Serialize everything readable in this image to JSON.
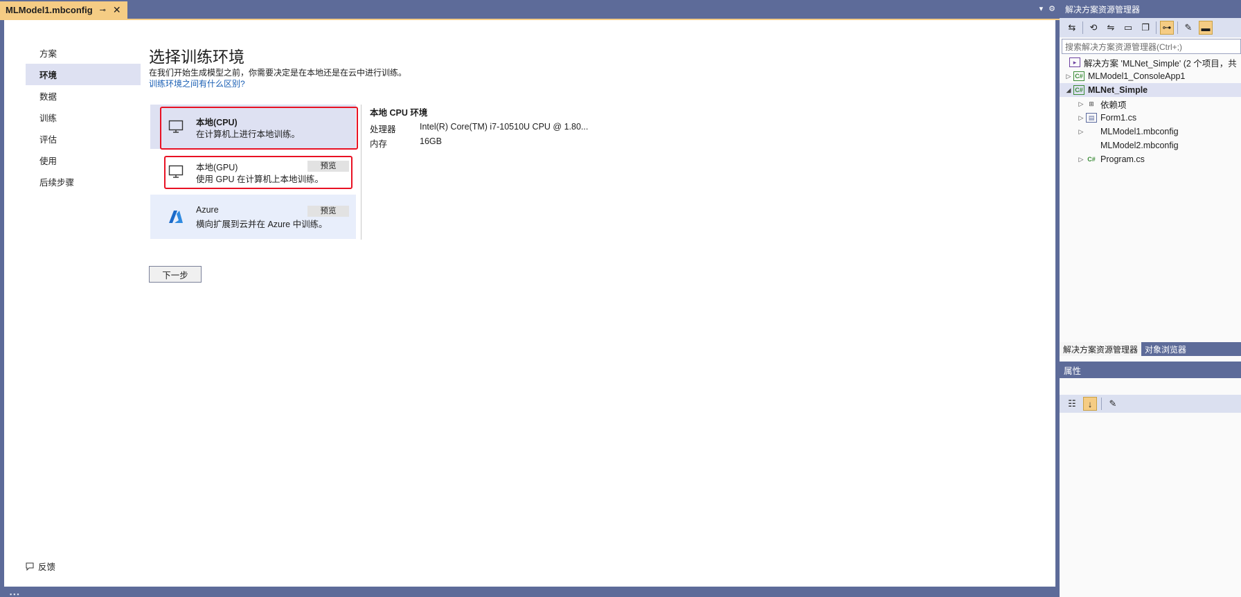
{
  "document_tab": {
    "title": "MLModel1.mbconfig",
    "pin_icon": "pin-icon",
    "close_icon": "close-icon"
  },
  "nav": {
    "items": [
      "方案",
      "环境",
      "数据",
      "训练",
      "评估",
      "使用",
      "后续步骤"
    ],
    "selected": "环境"
  },
  "main": {
    "title": "选择训练环境",
    "description": "在我们开始生成模型之前，你需要决定是在本地还是在云中进行训练。",
    "help_link": "训练环境之间有什么区别?",
    "environments": [
      {
        "name": "本地(CPU)",
        "description": "在计算机上进行本地训练。",
        "badge": "",
        "icon": "monitor-icon"
      },
      {
        "name": "本地(GPU)",
        "description": "使用 GPU 在计算机上本地训练。",
        "badge": "预览",
        "icon": "monitor-icon"
      },
      {
        "name": "Azure",
        "description": "横向扩展到云并在 Azure 中训练。",
        "badge": "预览",
        "icon": "azure-icon"
      }
    ],
    "details": {
      "title": "本地 CPU 环境",
      "rows": [
        {
          "key": "处理器",
          "value": "Intel(R) Core(TM) i7-10510U CPU @ 1.80..."
        },
        {
          "key": "内存",
          "value": "16GB"
        }
      ]
    },
    "next_button": "下一步",
    "feedback": "反馈"
  },
  "solution_explorer": {
    "title": "解决方案资源管理器",
    "search_placeholder": "搜索解决方案资源管理器(Ctrl+;)",
    "tree": [
      {
        "label": "解决方案 'MLNet_Simple' (2 个项目，共",
        "icon": "solution-icon",
        "expander": ""
      },
      {
        "label": "MLModel1_ConsoleApp1",
        "icon": "csproj-icon",
        "expander": "▷"
      },
      {
        "label": "MLNet_Simple",
        "icon": "csproj-icon",
        "expander": "◢",
        "bold": true
      },
      {
        "label": "依赖项",
        "icon": "dependencies-icon",
        "expander": "▷"
      },
      {
        "label": "Form1.cs",
        "icon": "form-icon",
        "expander": "▷"
      },
      {
        "label": "MLModel1.mbconfig",
        "icon": "",
        "expander": "▷"
      },
      {
        "label": "MLModel2.mbconfig",
        "icon": "",
        "expander": ""
      },
      {
        "label": "Program.cs",
        "icon": "csharp-icon",
        "expander": "▷"
      }
    ]
  },
  "bottom_tabs": [
    "解决方案资源管理器",
    "对象浏览器"
  ],
  "properties": {
    "title": "属性"
  },
  "colors": {
    "accent_tab": "#f5cc84",
    "chrome": "#5d6b99",
    "selection": "#dee1f2",
    "highlight_box": "#e81123",
    "link": "#1a5fb4"
  }
}
